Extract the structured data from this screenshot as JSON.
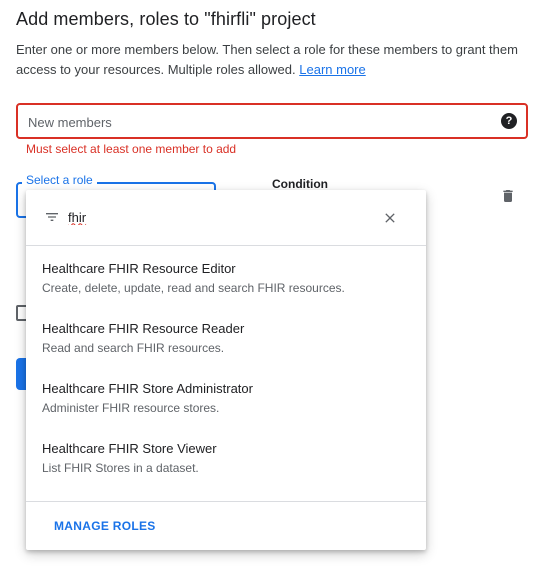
{
  "header": {
    "title": "Add members, roles to \"fhirfli\" project",
    "description": "Enter one or more members below. Then select a role for these members to grant them access to your resources. Multiple roles allowed.",
    "learn_more": "Learn more"
  },
  "members": {
    "placeholder": "New members",
    "help_icon": "help-icon",
    "error": "Must select at least one member to add"
  },
  "role": {
    "label": "Select a role",
    "condition_label": "Condition",
    "delete_icon": "trash-icon"
  },
  "dropdown": {
    "filter_icon": "filter-icon",
    "filter_value": "fhir",
    "close_icon": "close-icon",
    "options": [
      {
        "title": "Healthcare FHIR Resource Editor",
        "description": "Create, delete, update, read and search FHIR resources."
      },
      {
        "title": "Healthcare FHIR Resource Reader",
        "description": "Read and search FHIR resources."
      },
      {
        "title": "Healthcare FHIR Store Administrator",
        "description": "Administer FHIR resource stores."
      },
      {
        "title": "Healthcare FHIR Store Viewer",
        "description": "List FHIR Stores in a dataset."
      }
    ],
    "manage_roles": "MANAGE ROLES"
  },
  "colors": {
    "accent": "#1a73e8",
    "error": "#d93025",
    "text": "#202124"
  }
}
